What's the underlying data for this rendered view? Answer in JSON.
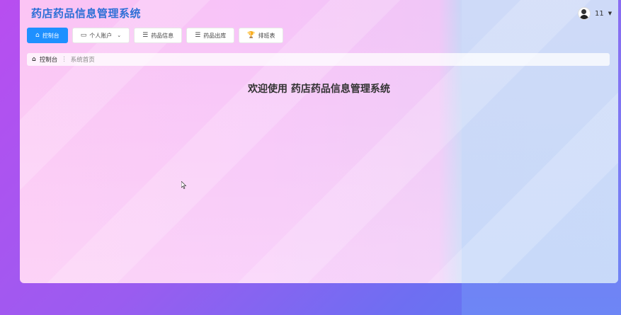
{
  "app": {
    "title": "药店药品信息管理系统"
  },
  "user": {
    "name": "11"
  },
  "nav": [
    {
      "label": "控制台",
      "icon": "home-icon"
    },
    {
      "label": "个人账户",
      "icon": "card-icon"
    },
    {
      "label": "药品信息",
      "icon": "list-icon"
    },
    {
      "label": "药品出库",
      "icon": "list-icon"
    },
    {
      "label": "排班表",
      "icon": "trophy-icon"
    }
  ],
  "breadcrumb": {
    "home": "控制台",
    "current": "系统首页"
  },
  "main": {
    "welcome": "欢迎使用 药店药品信息管理系统"
  },
  "colors": {
    "accent": "#1e90ff",
    "title": "#2d6fd6"
  }
}
